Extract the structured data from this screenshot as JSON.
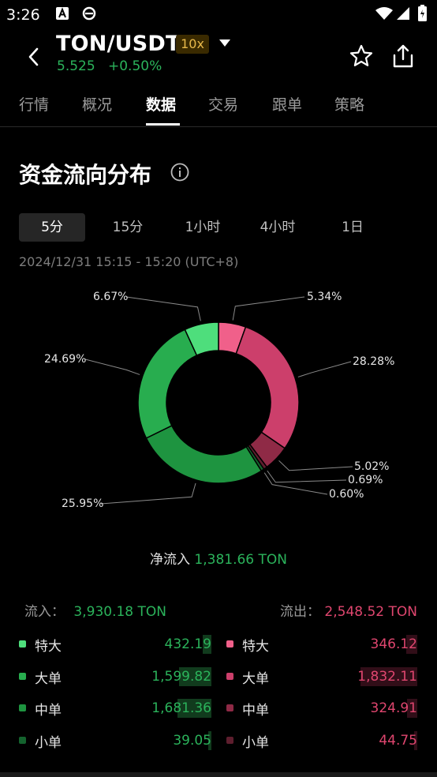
{
  "status_bar": {
    "time": "3:26"
  },
  "header": {
    "pair": "TON/USDT",
    "leverage": "10x",
    "price": "5.525",
    "change": "+0.50%"
  },
  "tabs": [
    "行情",
    "概况",
    "数据",
    "交易",
    "跟单",
    "策略"
  ],
  "active_tab": "数据",
  "section": {
    "title": "资金流向分布",
    "intervals": [
      "5分",
      "15分",
      "1小时",
      "4小时",
      "1日"
    ],
    "selected_interval": "5分",
    "date_range": "2024/12/31 15:15 - 15:20 (UTC+8)"
  },
  "chart_data": {
    "type": "pie",
    "donut": true,
    "slices": [
      {
        "label": "流出-特大",
        "value": 5.34,
        "label_text": "5.34%",
        "color": "#f0608a"
      },
      {
        "label": "流出-大单",
        "value": 28.28,
        "label_text": "28.28%",
        "color": "#cc3f6b"
      },
      {
        "label": "流出-中单",
        "value": 5.02,
        "label_text": "5.02%",
        "color": "#8f2a46"
      },
      {
        "label": "流出-小单",
        "value": 0.69,
        "label_text": "0.69%",
        "color": "#5e1e2e"
      },
      {
        "label": "流入-小单",
        "value": 0.6,
        "label_text": "0.60%",
        "color": "#14632e"
      },
      {
        "label": "流入-中单",
        "value": 25.95,
        "label_text": "25.95%",
        "color": "#1e9440"
      },
      {
        "label": "流入-大单",
        "value": 24.69,
        "label_text": "24.69%",
        "color": "#28ad4f"
      },
      {
        "label": "流入-特大",
        "value": 6.67,
        "label_text": "6.67%",
        "color": "#4ede7c"
      }
    ]
  },
  "net_flow": {
    "label": "净流入",
    "value": "1,381.66 TON"
  },
  "inflow": {
    "label": "流入：",
    "total": "3,930.18 TON",
    "rows": [
      {
        "label": "特大",
        "value": "432.19",
        "ratio": 0.11,
        "color": "#4ede7c"
      },
      {
        "label": "大单",
        "value": "1,599.82",
        "ratio": 0.41,
        "color": "#28ad4f"
      },
      {
        "label": "中单",
        "value": "1,681.36",
        "ratio": 0.43,
        "color": "#1e9440"
      },
      {
        "label": "小单",
        "value": "39.05",
        "ratio": 0.01,
        "color": "#14632e"
      }
    ]
  },
  "outflow": {
    "label": "流出：",
    "total": "2,548.52 TON",
    "rows": [
      {
        "label": "特大",
        "value": "346.12",
        "ratio": 0.14,
        "color": "#f0608a"
      },
      {
        "label": "大单",
        "value": "1,832.11",
        "ratio": 0.72,
        "color": "#cc3f6b"
      },
      {
        "label": "中单",
        "value": "324.91",
        "ratio": 0.13,
        "color": "#8f2a46"
      },
      {
        "label": "小单",
        "value": "44.75",
        "ratio": 0.02,
        "color": "#5e1e2e"
      }
    ]
  },
  "colors": {
    "up": "#2bb35b",
    "down": "#e0466f"
  }
}
